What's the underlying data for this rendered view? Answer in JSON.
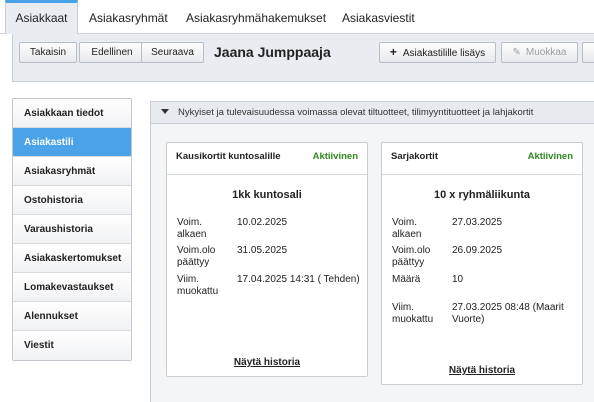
{
  "tabs": [
    "Asiakkaat",
    "Asiakasryhmät",
    "Asiakasryhmähakemukset",
    "Asiakasviestit"
  ],
  "toolbar": {
    "back": "Takaisin",
    "prev": "Edellinen",
    "next": "Seuraava",
    "customer_name": "Jaana Jumppaaja",
    "add_product": "Asiakastilille lisäys",
    "edit": "Muokkaa"
  },
  "sidebar": {
    "items": [
      "Asiakkaan tiedot",
      "Asiakastili",
      "Asiakasryhmät",
      "Ostohistoria",
      "Varaushistoria",
      "Asiakaskertomukset",
      "Lomakevastaukset",
      "Alennukset",
      "Viestit"
    ],
    "active": "Asiakastili"
  },
  "panel": {
    "header": "Nykyiset ja tulevaisuudessa voimassa olevat tiltuotteet, tilimyyntituotteet ja lahjakortit"
  },
  "cards": [
    {
      "type": "Kausikortit kuntosalille",
      "status": "Aktiivinen",
      "title": "1kk kuntosali",
      "rows": [
        {
          "label": "Voim. alkaen",
          "value": "10.02.2025"
        },
        {
          "label": "Voim.olo päättyy",
          "value": "31.05.2025"
        },
        {
          "label": "Viim. muokattu",
          "value": "17.04.2025 14:31 ( Tehden)"
        }
      ],
      "history_link": "Näytä historia"
    },
    {
      "type": "Sarjakortit",
      "status": "Aktiivinen",
      "title": "10 x ryhmäliikunta",
      "rows": [
        {
          "label": "Voim. alkaen",
          "value": "27.03.2025"
        },
        {
          "label": "Voim.olo päättyy",
          "value": "26.09.2025"
        },
        {
          "label": "Määrä",
          "value": "10"
        },
        {
          "label": "Viim. muokattu",
          "value": "27.03.2025 08:48 (Maarit Vuorte)"
        }
      ],
      "history_link": "Näytä historia"
    }
  ],
  "colors": {
    "accent": "#4aa3e8",
    "active_status": "#2f8a1f"
  }
}
